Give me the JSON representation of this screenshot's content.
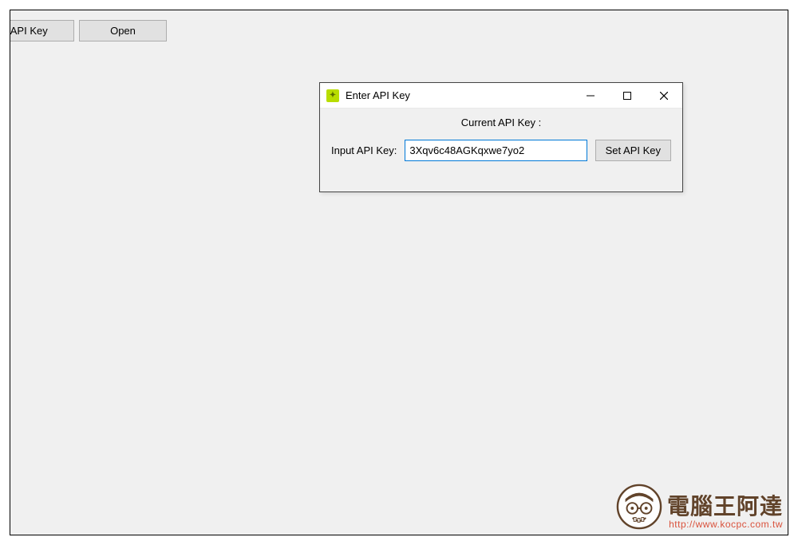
{
  "toolbar": {
    "api_key_button": "t API Key",
    "open_button": "Open"
  },
  "dialog": {
    "title": "Enter API Key",
    "current_key_label": "Current API Key :",
    "input_label": "Input API Key:",
    "input_value": "3Xqv6c48AGKqxwe7yo2",
    "set_button": "Set API Key"
  },
  "watermark": {
    "title": "電腦王阿達",
    "url": "http://www.kocpc.com.tw"
  }
}
